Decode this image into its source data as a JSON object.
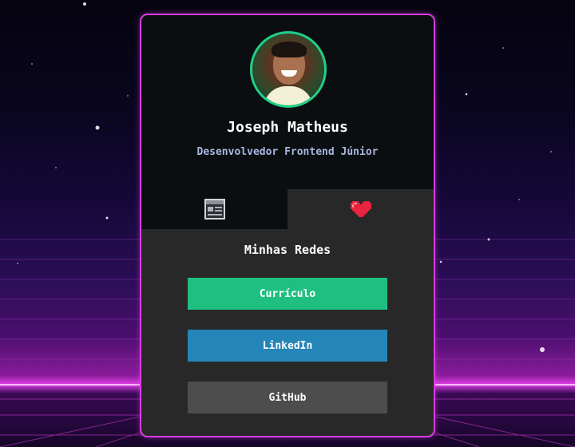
{
  "profile": {
    "name": "Joseph Matheus",
    "role": "Desenvolvedor Frontend Júnior"
  },
  "tabs": [
    {
      "icon": "browser-window-icon"
    },
    {
      "icon": "pixel-heart-icon"
    }
  ],
  "links_section": {
    "title": "Minhas Redes",
    "buttons": [
      {
        "label": "Currículo",
        "color": "#1fbf82"
      },
      {
        "label": "LinkedIn",
        "color": "#2485b8"
      },
      {
        "label": "GitHub",
        "color": "#4d4d4d"
      }
    ]
  },
  "colors": {
    "card_border": "#d63ee0",
    "avatar_ring": "#1fcf8a",
    "role_text": "#aab6e0"
  }
}
